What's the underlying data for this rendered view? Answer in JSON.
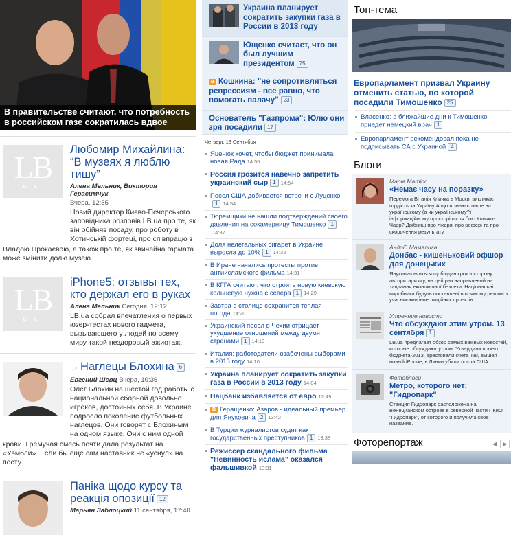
{
  "left": {
    "hero_caption": "В правительстве считают, что потребность в российском газе сократилась вдвое",
    "stories": [
      {
        "title": "Любомир Михайлина: “В музеях я люблю тишу”",
        "byline": "Алена Мельник, Виктория Герасимчук",
        "date": "Вчера, 12:55",
        "lead": "Новий директор Києво-Печерського заповідника розповів LB.ua про те, як він обійняв посаду, про роботу в Хотинській фортеці, про співпрацю з",
        "lead_full": "Владою Прокаєвою, а також про те, як звичайна гармата може змінити долю музею."
      },
      {
        "title": "iPhone5: отзывы тех, кто держал его в руках",
        "byline": "Алена Мельник",
        "date": "Сегодня, 12:12",
        "lead": "LB.ua собрал впечатления о первых юзер-тестах нового гаджета, вызывающего у людей по всему миру такой нездоровый ажиотаж."
      },
      {
        "title": "Наглецы Блохина",
        "badge": "6",
        "byline": "Евгений Шевц",
        "date": "Вчера, 10:36",
        "lead": "Олег Блохин на шестой год работы с национальной сборной довольно игроков, достойных себя. В Украине подросло поколение футбольных наглецов. Они говорят с Блохиным на одном языке. Они с ним одной",
        "lead_full": "крови. Гремучая смесь почти дала результат на «Уэмбли». Если бы еще сам наставник не «уснул» на посту…"
      },
      {
        "title": "Паніка щодо курсу та реакція опозиції",
        "badge": "12",
        "byline": "Марьян Заблоцкий",
        "date": "11 сентября, 17:40"
      }
    ],
    "logo_big": "LB",
    "logo_small": "ua"
  },
  "middle": {
    "top_news": [
      {
        "text": "Украина планирует сократить закупки газа в России в 2013 году",
        "thumb": true
      },
      {
        "text": "Ющенко считает, что он был лучшим президентом",
        "badge": "75",
        "thumb": true
      },
      {
        "text": "Кошкина: \"не сопротивляться репрессиям - все равно, что помогать палачу\"",
        "badge": "23",
        "icon": "B"
      },
      {
        "text": "Основатель \"Газпрома\": Юлю они зря посадили",
        "badge": "17"
      }
    ],
    "date_head": "Четверг, 13 Сентября",
    "feed": [
      {
        "text": "Яценюк хочет, чтобы бюджет принимала новая Рада",
        "time": "14:55"
      },
      {
        "text": "Россия грозится навечно запретить украинский сыр",
        "badge": "1",
        "time": "14:54",
        "bold": true
      },
      {
        "text": "Посол США добивается встречи с Луценко",
        "badge": "1",
        "time": "14:54"
      },
      {
        "text": "Тюремщики не нашли подтверждений своего давления на сокамерницу Тимошенко",
        "badge": "1",
        "time": "14:37"
      },
      {
        "text": "Доля нелегальных сигарет в Украине выросла до 10%",
        "badge": "1",
        "time": "14:32"
      },
      {
        "text": "В Иране начались протесты против антиисламского фильма",
        "time": "14:31"
      },
      {
        "text": "В КГГА считают, что строить новую киевскую кольцевую нужно с севера",
        "badge": "1",
        "time": "14:29"
      },
      {
        "text": "Завтра в столице сохранится теплая погода",
        "time": "14:20"
      },
      {
        "text": "Украинский посол в Чехии отрицает ухудшение отношений между двумя странами",
        "badge": "1",
        "time": "14:13"
      },
      {
        "text": "Италия: работодатели озабочены выборами в 2013 году",
        "time": "14:10"
      },
      {
        "text": "Украина планирует сократить закупки газа в России в 2013 году",
        "time": "14:04",
        "bold": true
      },
      {
        "text": "Нацбанк избавляется от евро",
        "time": "13:49",
        "bold": true
      },
      {
        "text": "Геращенко: Азаров - идеальный премьер для Януковича",
        "badge": "2",
        "time": "13:42",
        "icon": "B"
      },
      {
        "text": "В Турции журналистов судят как государственных преступников",
        "badge": "1",
        "time": "13:38"
      },
      {
        "text": "Режиссер скандального фильма \"Невинность ислама\" оказался фальшивкой",
        "time": "13:31",
        "bold": true
      }
    ]
  },
  "right": {
    "top_title": "Топ-тема",
    "top_headline": "Европарламент призвал Украину отменить статью, по которой посадили Тимошенко",
    "top_badge": "25",
    "top_list": [
      {
        "text": "Власенко: в ближайшие дни к Тимошенко приедет немецкий врач",
        "badge": "1"
      },
      {
        "text": "Европарламент рекомендовал пока не подписывать СА с Украиной",
        "badge": "4"
      }
    ],
    "blogs_title": "Блоги",
    "blogs": [
      {
        "author": "Марія Матіос",
        "title": "«Немає часу на поразку»",
        "text": "Перемога Віталія Кличка в Москві викликає гордість за Україну А що я знаю є лише на українському (а чи українському?) інформаційному просторі після бою Кличко-Чарр? Дрібниці про лікаря, про рефері та про скорочення результату"
      },
      {
        "author": "Андрій Мамалига",
        "title": "Донбас - кишеньковий офшор для донецьких",
        "text": "Янукович вчиться щоб один крок в сторону авторитаризму, на цей раз направлений на завдання економічної безпеки. Національні виробники будуть поставлені в прямому режимі з учасниками інвестиційних проектів"
      },
      {
        "author": "Утренние новости",
        "title": "Что обсуждают этим утром. 13 сентября",
        "badge": "1",
        "text": "LB.ua предлагает обзор самых важных новостей, которые обсуждают утром. Утвердили проект бюджета-2013, арестовали счета ТВі, вышел новый iPhone, в Ливии убили посла США."
      },
      {
        "author": "Фотоблоги",
        "title": "Метро, которого нет: \"Гидропарк\"",
        "text": "Станция Гидропарк расположена на Венецианском острове в северной части ПКиО \"Гидропарк\", от которого и получила свое название."
      }
    ],
    "photo_title": "Фоторепортаж",
    "arrow_prev": "◀",
    "arrow_next": "▶"
  }
}
